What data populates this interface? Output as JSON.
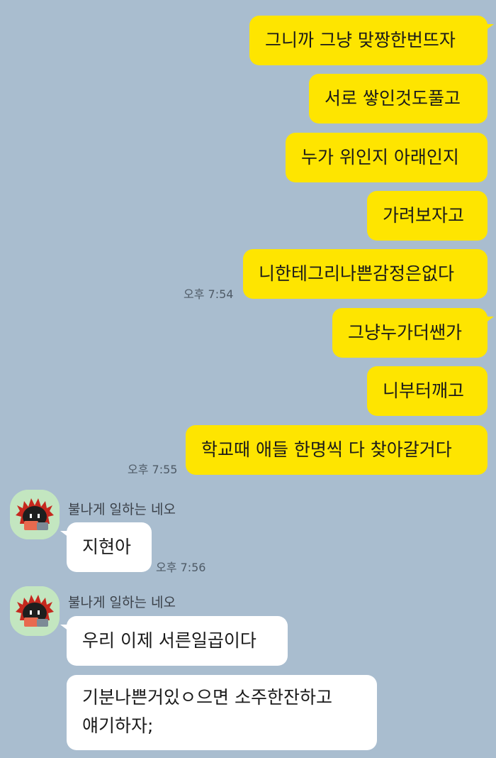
{
  "messages": {
    "m1": "그니까 그냥 맞짱한번뜨자",
    "m2": "서로 쌓인것도풀고",
    "m3": "누가 위인지 아래인지",
    "m4": "가려보자고",
    "m5": "니한테그리나쁜감정은없다",
    "m6": "그냥누가더쌘가",
    "m7": "니부터깨고",
    "m8": "학교때 애들 한명씩 다 찾아갈거다",
    "r1": "지현아",
    "r2": "우리 이제 서른일곱이다",
    "r3_line1": "기분나쁜거있ㅇ으면 소주한잔하고",
    "r3_line2": "얘기하자;"
  },
  "times": {
    "t1": "오후 7:54",
    "t2": "오후 7:55",
    "t3": "오후 7:56"
  },
  "sender": {
    "name": "불나게 일하는 네오"
  },
  "colors": {
    "background": "#a9bdcf",
    "my_bubble": "#fee500",
    "their_bubble": "#ffffff"
  }
}
